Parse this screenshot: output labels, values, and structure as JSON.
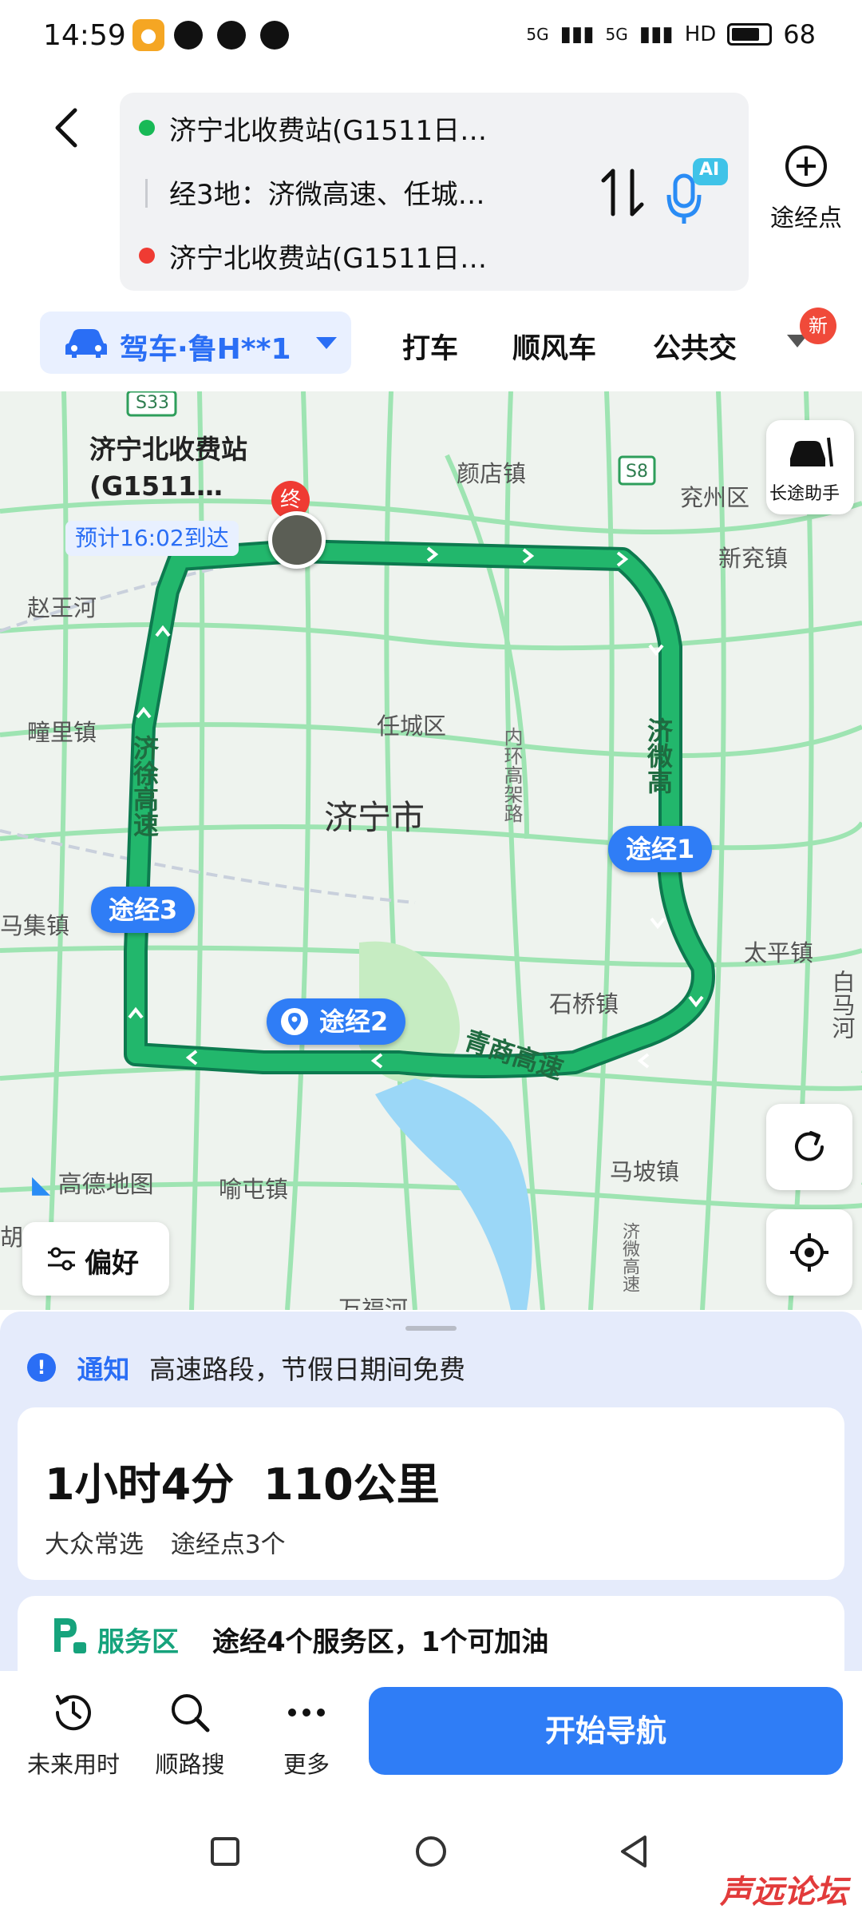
{
  "status_bar": {
    "time": "14:59",
    "signal_1": "5G",
    "signal_2": "5G",
    "hd": "HD",
    "battery": "68"
  },
  "route_header": {
    "origin": "济宁北收费站(G1511日…",
    "via": "经3地：济微高速、任城…",
    "destination": "济宁北收费站(G1511日…",
    "ai_badge": "AI",
    "add_waypoint_label": "途经点"
  },
  "transport_tabs": {
    "drive": "驾车·鲁H**1",
    "taxi": "打车",
    "carpool": "顺风车",
    "transit": "公共交",
    "new_badge": "新"
  },
  "map": {
    "dest_name": "济宁北收费站(G1511…",
    "dest_marker": "终",
    "eta": "预计16:02到达",
    "long_trip_assistant": "长途助手",
    "brand": "高德地图",
    "preference": "偏好",
    "waypoints": [
      "途经1",
      "途经2",
      "途经3"
    ],
    "places": [
      "颜店镇",
      "兖州区",
      "新兖镇",
      "赵王河",
      "疃里镇",
      "任城区",
      "济宁市",
      "马集镇",
      "太平镇",
      "石桥镇",
      "马坡镇",
      "喻屯镇",
      "万福河",
      "白马河",
      "胡"
    ],
    "roads": [
      "济徐高速",
      "济微高",
      "青商高速",
      "内环高架路",
      "济微高速",
      "S33",
      "S8"
    ]
  },
  "notice": {
    "icon": "!",
    "title": "通知",
    "message": "高速路段，节假日期间免费"
  },
  "route_summary": {
    "duration": "1小时4分",
    "distance": "110公里",
    "tag": "大众常选",
    "waypoints_count": "途经点3个"
  },
  "service_area": {
    "title": "服务区",
    "detail": "途经4个服务区，1个可加油"
  },
  "actions": {
    "future_time": "未来用时",
    "along_search": "顺路搜",
    "more": "更多",
    "start": "开始导航"
  },
  "watermark": "声远论坛"
}
